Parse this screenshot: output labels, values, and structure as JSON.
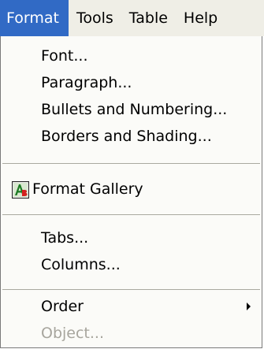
{
  "menubar": {
    "items": [
      "Format",
      "Tools",
      "Table",
      "Help"
    ],
    "active_index": 0
  },
  "menu": {
    "font": "Font...",
    "paragraph": "Paragraph...",
    "bullets": "Bullets and Numbering...",
    "borders": "Borders and Shading...",
    "format_gallery": "Format Gallery",
    "tabs": "Tabs...",
    "columns": "Columns...",
    "order": "Order",
    "object": "Object..."
  },
  "icons": {
    "format_gallery": "format-gallery-icon",
    "order_submenu": "submenu-arrow-icon"
  },
  "colors": {
    "highlight": "#316ac5",
    "disabled_text": "#a7a59d"
  }
}
